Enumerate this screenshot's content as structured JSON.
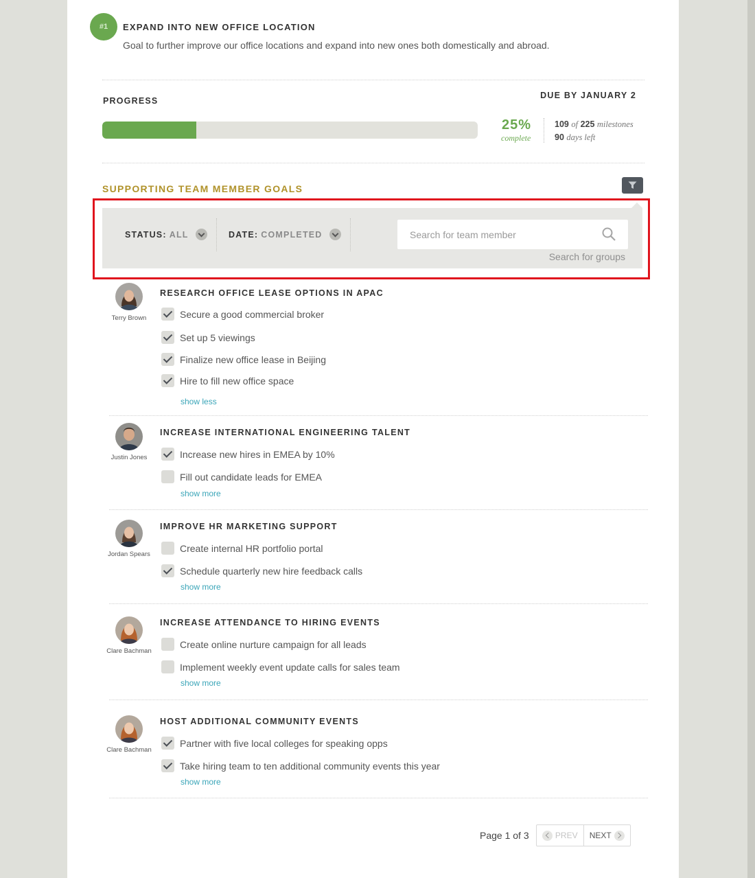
{
  "goal": {
    "badge": "#1",
    "title": "EXPAND INTO NEW OFFICE LOCATION",
    "description": "Goal to further improve our office locations and expand into new ones both domestically and abroad."
  },
  "progress": {
    "label": "PROGRESS",
    "due": "DUE BY JANUARY 2",
    "percent_value": 25,
    "percent": "25%",
    "complete_label": "complete",
    "milestones_done": "109",
    "of_label": "of",
    "milestones_total": "225",
    "milestones_label": "milestones",
    "days_left": "90",
    "days_label": "days left",
    "bar_color": "#6aa84f"
  },
  "supporting": {
    "title": "SUPPORTING TEAM MEMBER GOALS",
    "filter_icon": "filter-icon",
    "status_label": "STATUS:",
    "status_value": "ALL",
    "date_label": "DATE:",
    "date_value": "COMPLETED",
    "search_placeholder": "Search for team member",
    "search_groups": "Search for groups"
  },
  "groups": [
    {
      "member": "Terry Brown",
      "title": "RESEARCH OFFICE LEASE OPTIONS IN APAC",
      "tasks": [
        {
          "label": "Secure a good commercial broker",
          "done": true
        },
        {
          "label": "Set up 5 viewings",
          "done": true
        },
        {
          "label": "Finalize new office lease in Beijing",
          "done": true
        },
        {
          "label": "Hire to fill new office space",
          "done": true
        }
      ],
      "link": "show less"
    },
    {
      "member": "Justin Jones",
      "title": "INCREASE INTERNATIONAL ENGINEERING TALENT",
      "tasks": [
        {
          "label": "Increase new hires in EMEA by 10%",
          "done": true
        },
        {
          "label": "Fill out candidate leads for EMEA",
          "done": false
        }
      ],
      "link": "show more"
    },
    {
      "member": "Jordan Spears",
      "title": "IMPROVE HR MARKETING SUPPORT",
      "tasks": [
        {
          "label": "Create internal HR portfolio portal",
          "done": false
        },
        {
          "label": "Schedule quarterly new hire feedback calls",
          "done": true
        }
      ],
      "link": "show more"
    },
    {
      "member": "Clare Bachman",
      "title": "INCREASE ATTENDANCE TO HIRING EVENTS",
      "tasks": [
        {
          "label": "Create online nurture campaign for all leads",
          "done": false
        },
        {
          "label": "Implement weekly event update calls for sales team",
          "done": false
        }
      ],
      "link": "show more"
    },
    {
      "member": "Clare Bachman",
      "title": "HOST ADDITIONAL COMMUNITY EVENTS",
      "tasks": [
        {
          "label": "Partner with five local colleges for speaking opps",
          "done": true
        },
        {
          "label": "Take hiring team to ten additional community events this year",
          "done": true
        }
      ],
      "link": "show more"
    }
  ],
  "pagination": {
    "info": "Page 1 of 3",
    "prev": "PREV",
    "next": "NEXT"
  }
}
